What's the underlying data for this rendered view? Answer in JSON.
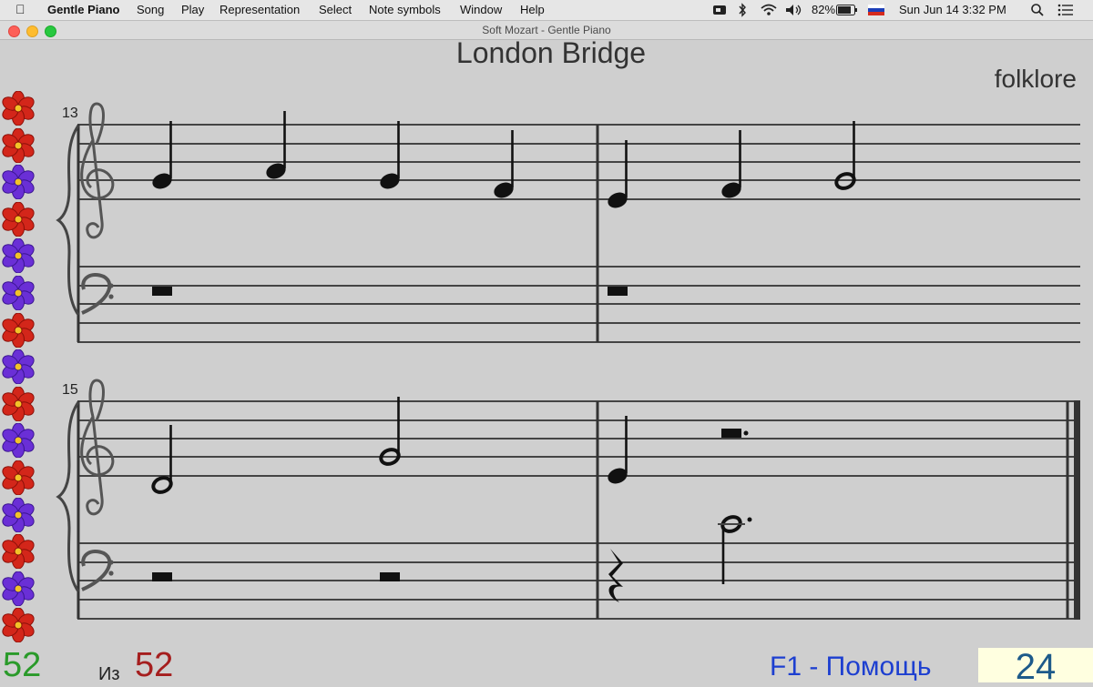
{
  "menubar": {
    "app_name": "Gentle Piano",
    "items": [
      "Song",
      "Play",
      "Representation",
      "Select",
      "Note symbols",
      "Window",
      "Help"
    ],
    "battery": "82%",
    "datetime": "Sun Jun 14  3:32 PM"
  },
  "window": {
    "title": "Soft Mozart - Gentle Piano"
  },
  "song": {
    "title": "London Bridge",
    "author": "folklore",
    "systems": [
      {
        "measure_number": "13"
      },
      {
        "measure_number": "15"
      }
    ]
  },
  "status": {
    "current": "52",
    "of_label": "Из",
    "total": "52",
    "help": "F1 - Помощь",
    "counter": "24"
  },
  "colors": {
    "current": "#2a9a2a",
    "total": "#a51e1e",
    "help": "#1d3fd0",
    "counter_bg": "#ffffe0",
    "counter_text": "#1d5a8a"
  },
  "flowers": [
    "red",
    "red",
    "purple",
    "red",
    "purple",
    "purple",
    "red",
    "purple",
    "red",
    "purple",
    "red",
    "purple",
    "red",
    "purple",
    "red"
  ]
}
